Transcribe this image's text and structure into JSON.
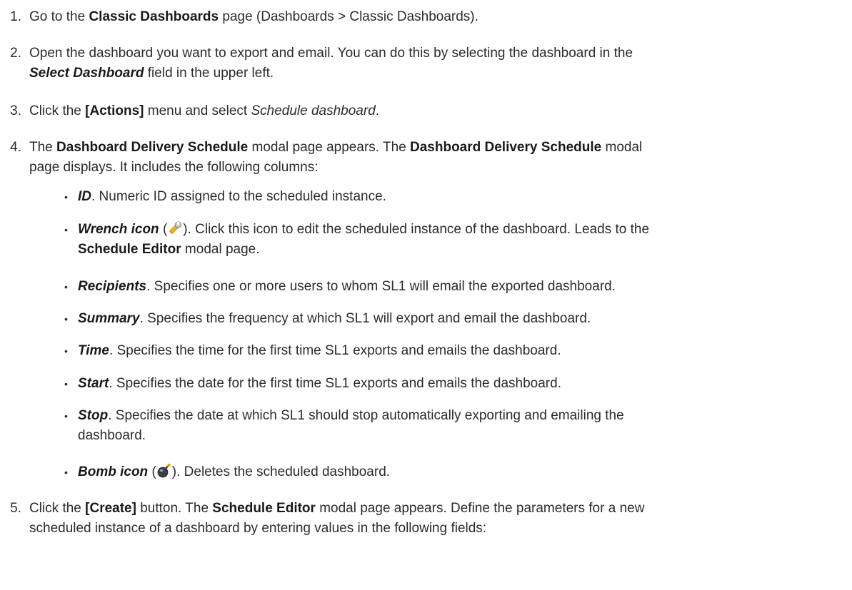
{
  "steps": [
    {
      "num": "1.",
      "pre": "Go to the ",
      "b1": "Classic Dashboards",
      "post": " page (Dashboards > Classic Dashboards)."
    },
    {
      "num": "2.",
      "line1": "Open the dashboard you want to export and email. You can do this by selecting the dashboard in the",
      "field": "Select Dashboard",
      "line2_post": " field in the upper left."
    },
    {
      "num": "3.",
      "pre": "Click the ",
      "b1": "[Actions]",
      "mid": " menu and select ",
      "i1": "Schedule dashboard",
      "post": "."
    },
    {
      "num": "4.",
      "pre": "The ",
      "b1": "Dashboard Delivery Schedule",
      "mid": " modal page appears. The ",
      "b2": "Dashboard Delivery Schedule",
      "post": " modal",
      "line2": "page displays. It includes the following columns:"
    },
    {
      "num": "5.",
      "pre": "Click the ",
      "b1": "[Create]",
      "mid": " button. The ",
      "b2": "Schedule Editor",
      "post": " modal page appears. Define the parameters for a new",
      "line2": "scheduled instance of a dashboard by entering values in the following fields:"
    }
  ],
  "columns": [
    {
      "term": "ID",
      "desc": ". Numeric ID assigned to the scheduled instance."
    },
    {
      "term": "Wrench icon",
      "icon": "wrench-icon",
      "open": " (",
      "close": "). Click this icon to edit the scheduled instance of the dashboard. Leads to the",
      "link": "Schedule Editor",
      "tail": " modal page."
    },
    {
      "term": "Recipients",
      "desc": ". Specifies one or more users to whom SL1 will email the exported dashboard."
    },
    {
      "term": "Summary",
      "desc": ". Specifies the frequency at which SL1 will export and email the dashboard."
    },
    {
      "term": "Time",
      "desc": ". Specifies the time for the first time SL1 exports and emails the dashboard."
    },
    {
      "term": "Start",
      "desc": ". Specifies the date for the first time SL1 exports and emails the dashboard."
    },
    {
      "term": "Stop",
      "desc": ". Specifies the date at which SL1 should stop automatically exporting and emailing the",
      "line2": "dashboard."
    },
    {
      "term": "Bomb icon",
      "icon": "bomb-icon",
      "open": " (",
      "close": "). Deletes the scheduled dashboard."
    }
  ],
  "bullet_char": "•"
}
